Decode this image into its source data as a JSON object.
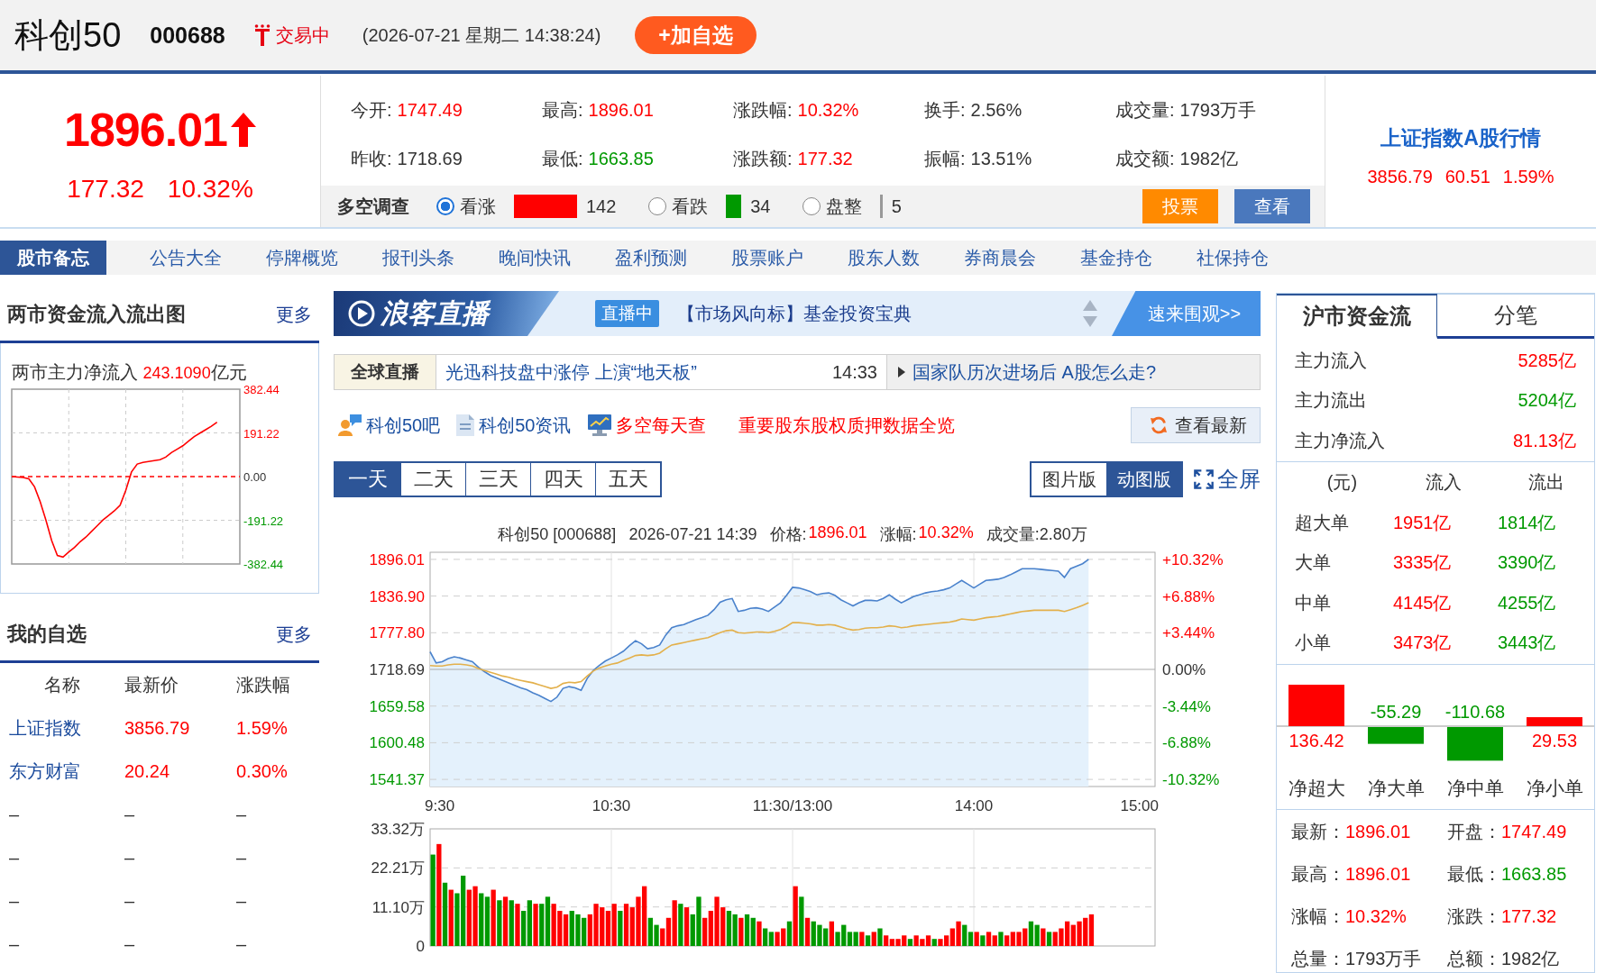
{
  "header": {
    "name": "科创50",
    "code": "000688",
    "status": "交易中",
    "datetime": "(2026-07-21 星期二 14:38:24)",
    "add_button": "+加自选"
  },
  "quote": {
    "up": true,
    "price": "1896.01",
    "change": "177.32",
    "change_pct": "10.32%",
    "stats": [
      {
        "label": "今开:",
        "value": "1747.49",
        "color": "#ff0000"
      },
      {
        "label": "最高:",
        "value": "1896.01",
        "color": "#ff0000"
      },
      {
        "label": "涨跌幅:",
        "value": "10.32%",
        "color": "#ff0000"
      },
      {
        "label": "换手:",
        "value": "2.56%",
        "color": "#333333"
      },
      {
        "label": "成交量:",
        "value": "1793万手",
        "color": "#333333"
      },
      {
        "label": "昨收:",
        "value": "1718.69",
        "color": "#333333"
      },
      {
        "label": "最低:",
        "value": "1663.85",
        "color": "#009900"
      },
      {
        "label": "涨跌额:",
        "value": "177.32",
        "color": "#ff0000"
      },
      {
        "label": "振幅:",
        "value": "13.51%",
        "color": "#333333"
      },
      {
        "label": "成交额:",
        "value": "1982亿",
        "color": "#333333"
      }
    ],
    "survey": {
      "title": "多空调查",
      "options": [
        {
          "label": "看涨",
          "selected": true,
          "color": "#ff0000",
          "count": "142"
        },
        {
          "label": "看跌",
          "selected": false,
          "color": "#009900",
          "count": "34"
        },
        {
          "label": "盘整",
          "selected": false,
          "color": "#999999",
          "count": "5"
        }
      ],
      "buttons": [
        {
          "label": "投票",
          "kind": "vote"
        },
        {
          "label": "查看",
          "kind": "view"
        }
      ]
    },
    "index_box": {
      "title": "上证指数A股行情",
      "values": [
        "3856.79",
        "60.51",
        "1.59%"
      ]
    }
  },
  "nav": [
    {
      "label": "股市备忘",
      "selected": true
    },
    {
      "label": "公告大全",
      "selected": false
    },
    {
      "label": "停牌概览",
      "selected": false
    },
    {
      "label": "报刊头条",
      "selected": false
    },
    {
      "label": "晚间快讯",
      "selected": false
    },
    {
      "label": "盈利预测",
      "selected": false
    },
    {
      "label": "股票账户",
      "selected": false
    },
    {
      "label": "股东人数",
      "selected": false
    },
    {
      "label": "券商晨会",
      "selected": false
    },
    {
      "label": "基金持仓",
      "selected": false
    },
    {
      "label": "社保持仓",
      "selected": false
    }
  ],
  "left": {
    "flow": {
      "title": "两市资金流入流出图",
      "more": "更多",
      "caption": "两市主力净流入",
      "value": "243.1090",
      "unit": "亿元",
      "chart_data": [
        {
          "type": "line",
          "categories": [
            null,
            null,
            null,
            null,
            null,
            null,
            null,
            null,
            null,
            null,
            null,
            null,
            null,
            null,
            null,
            null,
            null,
            null,
            null,
            null,
            null,
            null,
            null,
            null,
            null,
            null,
            null,
            null,
            null,
            null,
            null,
            null,
            null,
            null,
            null,
            null,
            null,
            null,
            null,
            null,
            null
          ],
          "values": [
            0,
            -2,
            -4,
            -10,
            -45,
            -110,
            -190,
            -280,
            -345,
            -352,
            -330,
            -310,
            -285,
            -265,
            -240,
            -215,
            -190,
            -170,
            -150,
            -125,
            -60,
            20,
            55,
            62,
            66,
            70,
            74,
            85,
            105,
            120,
            135,
            155,
            175,
            190,
            205,
            220,
            238,
            null,
            null,
            null,
            null
          ],
          "color": "#ff0000",
          "ylim": [
            -382.44,
            382.44
          ],
          "yticks": [
            {
              "value": 382.44,
              "label": "382.44"
            },
            {
              "value": 191.22,
              "label": "191.22"
            },
            {
              "value": 0,
              "label": "0.00"
            },
            {
              "value": -191.22,
              "label": "-191.22"
            },
            {
              "value": -382.44,
              "label": "-382.44"
            }
          ],
          "tick_labels": "y",
          "grid": true,
          "ref_lines": [
            {
              "axis": "y",
              "value": 0,
              "color": "#ff0000",
              "line_style": "dashed"
            }
          ]
        }
      ]
    },
    "watchlist": {
      "title": "我的自选",
      "more": "更多",
      "columns": [
        "名称",
        "最新价",
        "涨跌幅"
      ],
      "rows": [
        {
          "kind": "stock",
          "name": "上证指数",
          "price": "3856.79",
          "change": "1.59%",
          "color": "#ff0000"
        },
        {
          "kind": "stock",
          "name": "东方财富",
          "price": "20.24",
          "change": "0.30%",
          "color": "#ff0000"
        },
        {
          "kind": "empty",
          "name": "–",
          "price": "–",
          "change": "–"
        },
        {
          "kind": "empty",
          "name": "–",
          "price": "–",
          "change": "–"
        },
        {
          "kind": "empty",
          "name": "–",
          "price": "–",
          "change": "–"
        },
        {
          "kind": "empty",
          "name": "–",
          "price": "–",
          "change": "–"
        }
      ]
    }
  },
  "middle": {
    "live_banner": {
      "logo": "浪客直播",
      "badge": "直播中",
      "headline": "【市场风向标】基金投资宝典",
      "cta": "速来围观>>"
    },
    "ticker": {
      "label": "全球直播",
      "headline": "光迅科技盘中涨停 上演“地天板”",
      "time": "14:33",
      "side_link": "国家队历次进场后 A股怎么走?"
    },
    "quick_links": [
      {
        "label": "科创50吧",
        "kind": "forum",
        "color": "#1a4fa0"
      },
      {
        "label": "科创50资讯",
        "kind": "news",
        "color": "#1a4fa0"
      },
      {
        "label": "多空每天查",
        "kind": "monitor",
        "color": "#ff0000"
      },
      {
        "label": "重要股东股权质押数据全览",
        "kind": "plain",
        "color": "#ff0000"
      }
    ],
    "refresh_button": "查看最新",
    "periods": [
      {
        "label": "一天",
        "selected": true
      },
      {
        "label": "二天",
        "selected": false
      },
      {
        "label": "三天",
        "selected": false
      },
      {
        "label": "四天",
        "selected": false
      },
      {
        "label": "五天",
        "selected": false
      }
    ],
    "views": [
      {
        "label": "图片版",
        "selected": false
      },
      {
        "label": "动图版",
        "selected": true
      }
    ],
    "fullscreen": "全屏",
    "chart_header": {
      "name": "科创50 [000688]",
      "time": "2026-07-21 14:39",
      "price_label": "价格:",
      "price": "1896.01",
      "change_label": "涨幅:",
      "change": "10.32%",
      "volume": "成交量:2.80万"
    },
    "chart_data": [
      {
        "type": "line",
        "categories": [
          "9:30",
          null,
          null,
          null,
          null,
          null,
          null,
          null,
          null,
          null,
          null,
          null,
          null,
          null,
          null,
          null,
          null,
          null,
          null,
          null,
          null,
          null,
          null,
          null,
          null,
          null,
          null,
          null,
          null,
          null,
          "10:30",
          null,
          null,
          null,
          null,
          null,
          null,
          null,
          null,
          null,
          null,
          null,
          null,
          null,
          null,
          null,
          null,
          null,
          null,
          null,
          null,
          null,
          null,
          null,
          null,
          null,
          null,
          null,
          null,
          null,
          "11:30/13:00",
          null,
          null,
          null,
          null,
          null,
          null,
          null,
          null,
          null,
          null,
          null,
          null,
          null,
          null,
          null,
          null,
          null,
          null,
          null,
          null,
          null,
          null,
          null,
          null,
          null,
          null,
          null,
          null,
          null,
          "14:00",
          null,
          null,
          null,
          null,
          null,
          null,
          null,
          null,
          null,
          null,
          null,
          null,
          null,
          null,
          null,
          null,
          null,
          null,
          null,
          null,
          null,
          null,
          null,
          null,
          null,
          null,
          null,
          null,
          null,
          "15:00"
        ],
        "ylim": [
          1529.9,
          1907.48
        ],
        "yticks": [
          {
            "value": 1896.01,
            "label": "1896.01"
          },
          {
            "value": 1836.9,
            "label": "1836.90"
          },
          {
            "value": 1777.8,
            "label": "1777.80"
          },
          {
            "value": 1718.69,
            "label": "1718.69"
          },
          {
            "value": 1659.58,
            "label": "1659.58"
          },
          {
            "value": 1600.48,
            "label": "1600.48"
          },
          {
            "value": 1541.37,
            "label": "1541.37"
          }
        ],
        "y2lim": [
          -10.98,
          10.98
        ],
        "y2ticks": [
          {
            "value": 10.32,
            "label": "+10.32%"
          },
          {
            "value": 6.88,
            "label": "+6.88%"
          },
          {
            "value": 3.44,
            "label": "+3.44%"
          },
          {
            "value": 0,
            "label": "0.00%"
          },
          {
            "value": -3.44,
            "label": "-3.44%"
          },
          {
            "value": -6.88,
            "label": "-6.88%"
          },
          {
            "value": -10.32,
            "label": "-10.32%"
          }
        ],
        "grid": true,
        "series": [
          {
            "type": "area",
            "color": "#4a82cc",
            "values": [
              1747,
              1729,
              1731,
              1736,
              1739,
              1737,
              1734,
              1731,
              1722,
              1715,
              1709,
              1705,
              1701,
              1697,
              1693,
              1689,
              1686,
              1681,
              1677,
              1672,
              1667,
              1674,
              1688,
              1691,
              1689,
              1685,
              1704,
              1717,
              1725,
              1732,
              1737,
              1742,
              1748,
              1757,
              1765,
              1760,
              1752,
              1754,
              1758,
              1774,
              1786,
              1789,
              1791,
              1795,
              1799,
              1802,
              1806,
              1815,
              1827,
              1831,
              1833,
              1812,
              1814,
              1817,
              1818,
              1816,
              1812,
              1819,
              1826,
              1838,
              1851,
              1850,
              1847,
              1844,
              1839,
              1841,
              1842,
              1838,
              1831,
              1826,
              1821,
              1826,
              1830,
              1830,
              1829,
              1833,
              1839,
              1832,
              1826,
              1831,
              1836,
              1839,
              1842,
              1844,
              1845,
              1847,
              1850,
              1856,
              1862,
              1856,
              1850,
              1856,
              1862,
              1863,
              1864,
              1867,
              1871,
              1876,
              1881,
              1881,
              1881,
              1880,
              1879,
              1878,
              1877,
              1867,
              1881,
              1885,
              1889,
              1896,
              null,
              null,
              null,
              null,
              null,
              null,
              null,
              null,
              null,
              null,
              null
            ]
          },
          {
            "type": "line",
            "color": "#e3b04b",
            "values": [
              1725,
              1724,
              1724,
              1726,
              1727,
              1727,
              1726,
              1724,
              1720,
              1717,
              1714,
              1711,
              1708,
              1706,
              1703,
              1701,
              1699,
              1697,
              1694,
              1691,
              1688,
              1690,
              1696,
              1698,
              1697,
              1699,
              1708,
              1716,
              1721,
              1724,
              1727,
              1729,
              1733,
              1737,
              1741,
              1742,
              1741,
              1742,
              1745,
              1752,
              1758,
              1760,
              1762,
              1764,
              1766,
              1768,
              1770,
              1774,
              1778,
              1781,
              1782,
              1778,
              1777,
              1778,
              1779,
              1779,
              1778,
              1780,
              1783,
              1788,
              1794,
              1794,
              1793,
              1792,
              1790,
              1790,
              1791,
              1790,
              1787,
              1784,
              1782,
              1783,
              1785,
              1786,
              1786,
              1787,
              1789,
              1788,
              1786,
              1787,
              1789,
              1790,
              1791,
              1792,
              1793,
              1794,
              1795,
              1797,
              1800,
              1799,
              1798,
              1800,
              1802,
              1803,
              1804,
              1806,
              1808,
              1810,
              1812,
              1813,
              1814,
              1814,
              1814,
              1814,
              1814,
              1812,
              1815,
              1818,
              1822,
              1826,
              null,
              null,
              null,
              null,
              null,
              null,
              null,
              null,
              null,
              null,
              null
            ]
          }
        ]
      },
      {
        "type": "bar",
        "categories": [
          null,
          null,
          null,
          null,
          null,
          null,
          null,
          null,
          null,
          null,
          null,
          null,
          null,
          null,
          null,
          null,
          null,
          null,
          null,
          null,
          null,
          null,
          null,
          null,
          null,
          null,
          null,
          null,
          null,
          null,
          null,
          null,
          null,
          null,
          null,
          null,
          null,
          null,
          null,
          null,
          null,
          null,
          null,
          null,
          null,
          null,
          null,
          null,
          null,
          null,
          null,
          null,
          null,
          null,
          null,
          null,
          null,
          null,
          null,
          null,
          null,
          null,
          null,
          null,
          null,
          null,
          null,
          null,
          null,
          null,
          null,
          null,
          null,
          null,
          null,
          null,
          null,
          null,
          null,
          null,
          null,
          null,
          null,
          null,
          null,
          null,
          null,
          null,
          null,
          null,
          null,
          null,
          null,
          null,
          null,
          null,
          null,
          null,
          null,
          null,
          null,
          null,
          null,
          null,
          null,
          null,
          null,
          null,
          null,
          null,
          null,
          null,
          null,
          null,
          null,
          null,
          null,
          null,
          null,
          null,
          null
        ],
        "ylim": [
          0,
          33.32
        ],
        "yticks": [
          {
            "value": 33.32,
            "label": "33.32万"
          },
          {
            "value": 22.21,
            "label": "22.21万"
          },
          {
            "value": 11.1,
            "label": "11.10万"
          },
          {
            "value": 0,
            "label": "0"
          }
        ],
        "tick_labels": "y",
        "grid": true,
        "values": [
          26,
          29,
          18,
          16,
          15,
          20,
          16,
          17,
          15,
          14,
          16,
          13,
          14,
          13,
          12,
          10,
          13,
          12,
          12,
          14,
          12,
          10,
          9,
          10,
          9,
          8,
          9,
          12,
          11,
          10,
          12,
          10,
          12,
          11,
          14,
          17,
          8,
          6,
          5,
          8,
          13,
          12,
          11,
          9,
          14,
          8,
          10,
          14,
          11,
          10,
          9,
          8,
          9,
          8,
          7,
          5,
          4,
          4,
          5,
          7,
          17,
          14,
          8,
          7,
          6,
          5,
          7,
          4,
          6,
          4,
          4,
          4,
          3,
          4,
          5,
          3,
          2,
          2,
          3,
          2,
          3,
          2,
          3,
          2,
          2,
          3,
          5,
          7,
          6,
          4,
          4,
          3,
          4,
          3,
          4,
          3,
          4,
          4,
          5,
          7,
          6,
          5,
          4,
          4,
          5,
          7,
          6,
          7,
          8,
          9,
          null,
          null,
          null,
          null,
          null,
          null,
          null,
          null,
          null,
          null,
          null
        ],
        "colors": [
          "#009900",
          "#ff0000",
          "#009900",
          "#ff0000",
          "#009900",
          "#009900",
          "#ff0000",
          "#ff0000",
          "#009900",
          "#009900",
          "#ff0000",
          "#009900",
          "#ff0000",
          "#009900",
          "#ff0000",
          "#009900",
          "#009900",
          "#ff0000",
          "#009900",
          "#009900",
          "#ff0000",
          "#ff0000",
          "#ff0000",
          "#009900",
          "#009900",
          "#009900",
          "#ff0000",
          "#ff0000",
          "#ff0000",
          "#ff0000",
          "#ff0000",
          "#009900",
          "#ff0000",
          "#ff0000",
          "#ff0000",
          "#ff0000",
          "#009900",
          "#009900",
          "#ff0000",
          "#ff0000",
          "#ff0000",
          "#009900",
          "#ff0000",
          "#009900",
          "#009900",
          "#ff0000",
          "#ff0000",
          "#ff0000",
          "#ff0000",
          "#009900",
          "#009900",
          "#ff0000",
          "#009900",
          "#009900",
          "#ff0000",
          "#009900",
          "#009900",
          "#ff0000",
          "#ff0000",
          "#009900",
          "#ff0000",
          "#009900",
          "#ff0000",
          "#009900",
          "#009900",
          "#009900",
          "#ff0000",
          "#009900",
          "#009900",
          "#009900",
          "#009900",
          "#ff0000",
          "#009900",
          "#ff0000",
          "#009900",
          "#ff0000",
          "#ff0000",
          "#ff0000",
          "#ff0000",
          "#009900",
          "#ff0000",
          "#ff0000",
          "#ff0000",
          "#009900",
          "#ff0000",
          "#ff0000",
          "#ff0000",
          "#ff0000",
          "#009900",
          "#009900",
          "#ff0000",
          "#009900",
          "#ff0000",
          "#ff0000",
          "#009900",
          "#ff0000",
          "#ff0000",
          "#ff0000",
          "#ff0000",
          "#009900",
          "#009900",
          "#ff0000",
          "#009900",
          "#ff0000",
          "#ff0000",
          "#ff0000",
          "#ff0000",
          "#ff0000",
          "#ff0000",
          "#ff0000",
          null,
          null,
          null,
          null,
          null,
          null,
          null,
          null,
          null,
          null,
          null
        ]
      }
    ]
  },
  "right": {
    "tabs": [
      {
        "label": "沪市资金流",
        "selected": true
      },
      {
        "label": "分笔",
        "selected": false
      }
    ],
    "summary": [
      {
        "label": "主力流入",
        "value": "5285亿",
        "color": "#ff0000"
      },
      {
        "label": "主力流出",
        "value": "5204亿",
        "color": "#009900"
      },
      {
        "label": "主力净流入",
        "value": "81.13亿",
        "color": "#ff0000"
      }
    ],
    "table": {
      "columns": [
        "(元)",
        "流入",
        "流出"
      ],
      "rows": [
        {
          "label": "超大单",
          "inflow": "1951亿",
          "outflow": "1814亿"
        },
        {
          "label": "大单",
          "inflow": "3335亿",
          "outflow": "3390亿"
        },
        {
          "label": "中单",
          "inflow": "4145亿",
          "outflow": "4255亿"
        },
        {
          "label": "小单",
          "inflow": "3473亿",
          "outflow": "3443亿"
        }
      ]
    },
    "chart_data": [
      {
        "type": "bar",
        "categories": [
          "净超大",
          "净大单",
          "净中单",
          "净小单"
        ],
        "values": [
          136.42,
          -55.29,
          -110.68,
          29.53
        ],
        "colors": [
          "#ff0000",
          "#009900",
          "#009900",
          "#ff0000"
        ],
        "data_labels": true
      }
    ],
    "stats": [
      {
        "label": "最新：",
        "value": "1896.01",
        "color": "#ff0000"
      },
      {
        "label": "开盘：",
        "value": "1747.49",
        "color": "#ff0000"
      },
      {
        "label": "最高：",
        "value": "1896.01",
        "color": "#ff0000"
      },
      {
        "label": "最低：",
        "value": "1663.85",
        "color": "#009900"
      },
      {
        "label": "涨幅：",
        "value": "10.32%",
        "color": "#ff0000"
      },
      {
        "label": "涨跌：",
        "value": "177.32",
        "color": "#ff0000"
      },
      {
        "label": "总量：",
        "value": "1793万手",
        "color": "#333333"
      },
      {
        "label": "总额：",
        "value": "1982亿",
        "color": "#333333"
      }
    ]
  }
}
